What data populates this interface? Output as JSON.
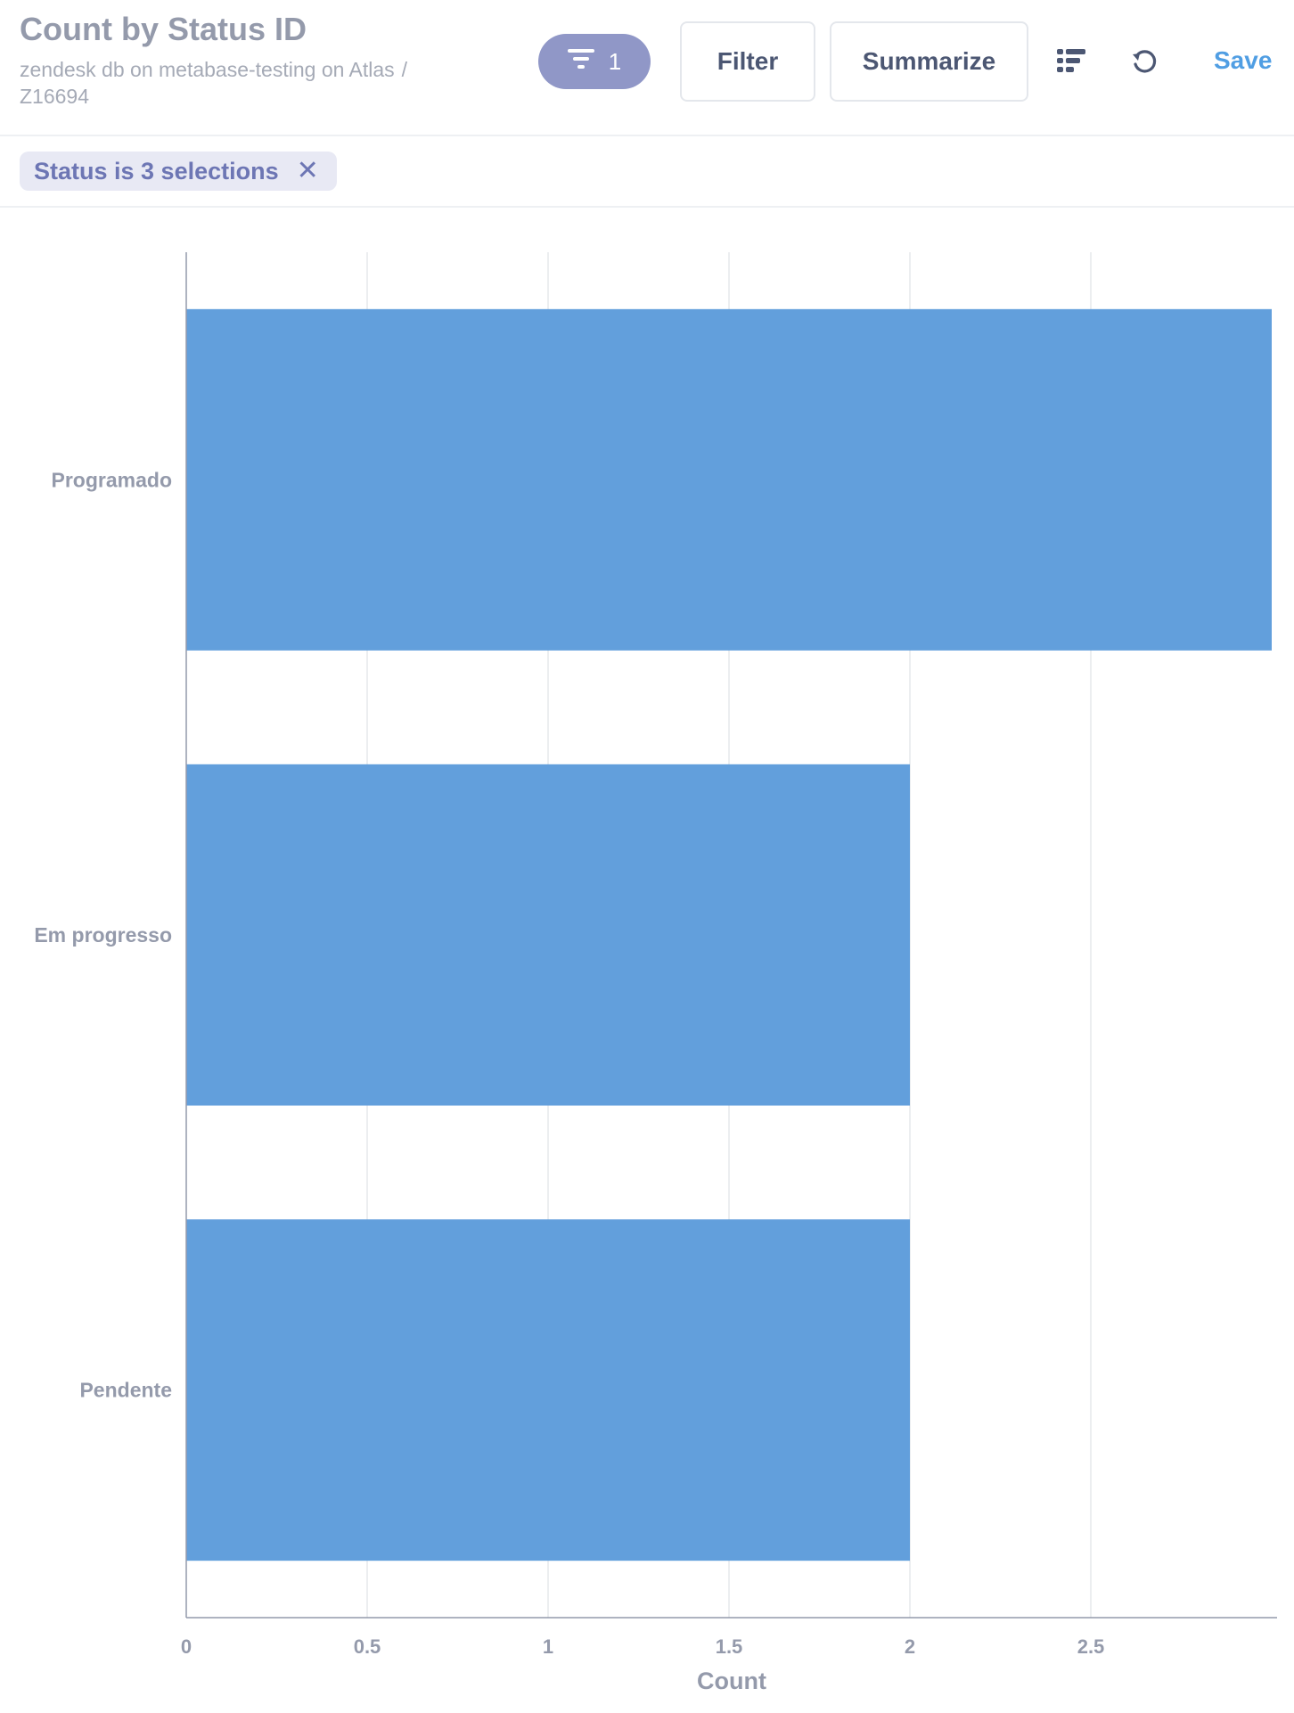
{
  "header": {
    "title": "Count by Status ID",
    "breadcrumb": {
      "source": "zendesk db on metabase-testing on Atlas",
      "separator": "/",
      "table": "Z16694"
    },
    "filter_count": "1",
    "filter_button": "Filter",
    "summarize_button": "Summarize",
    "save_label": "Save",
    "icons": {
      "filter": "filter-funnel-icon",
      "list": "list-icon",
      "refresh": "refresh-icon"
    }
  },
  "filters": {
    "chip_label": "Status is 3 selections",
    "chip_close": "✕"
  },
  "colors": {
    "bar": "#629fdc",
    "accent": "#509ee3",
    "filter_pill": "#9097c7"
  },
  "chart_data": {
    "type": "bar",
    "orientation": "horizontal",
    "categories": [
      "Programado",
      "Em progresso",
      "Pendente"
    ],
    "values": [
      3,
      2,
      2
    ],
    "xlabel": "Count",
    "ylabel": "",
    "xlim": [
      0,
      3
    ],
    "xticks": [
      "0",
      "0.5",
      "1",
      "1.5",
      "2",
      "2.5"
    ],
    "grid": true
  }
}
